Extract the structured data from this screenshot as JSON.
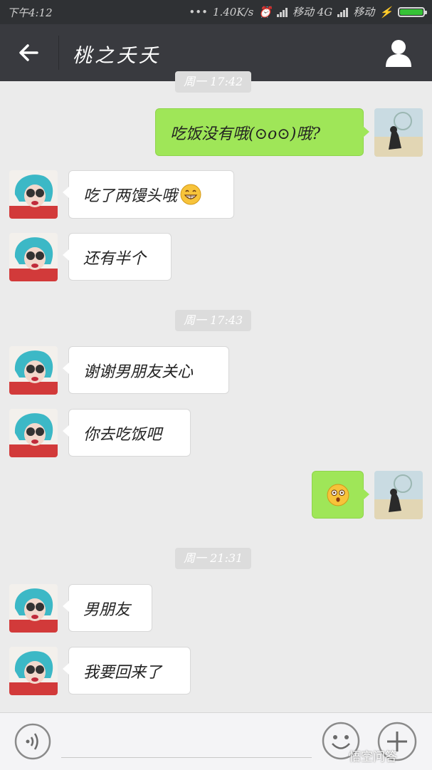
{
  "status_bar": {
    "time": "下午4:12",
    "right_text": "1.40K/s",
    "carrier1": "移动 4G",
    "carrier2": "移动"
  },
  "header": {
    "title": "桃之夭夭",
    "back_icon": "back-arrow-icon",
    "profile_icon": "person-icon"
  },
  "timestamps": [
    "周一 17:42",
    "周一 17:43",
    "周一 21:31"
  ],
  "messages": [
    {
      "side": "out",
      "text": "吃饭没有哦(⊙o⊙)哦?"
    },
    {
      "side": "in",
      "text": "吃了两馒头哦",
      "emoji": "grin-emoji"
    },
    {
      "side": "in",
      "text": "还有半个"
    },
    {
      "side": "in",
      "text": "谢谢男朋友关心"
    },
    {
      "side": "in",
      "text": "你去吃饭吧"
    },
    {
      "side": "out",
      "emoji": "surprised-emoji"
    },
    {
      "side": "in",
      "text": "男朋友"
    },
    {
      "side": "in",
      "text": "我要回来了"
    }
  ],
  "input_bar": {
    "voice_icon": "voice-icon",
    "emoji_icon": "smiley-icon",
    "plus_icon": "plus-icon"
  },
  "watermark": "悟空问答",
  "colors": {
    "outgoing_bubble": "#9fe658",
    "incoming_bubble": "#ffffff",
    "title_bar": "#393a3f",
    "background": "#ebebeb"
  }
}
